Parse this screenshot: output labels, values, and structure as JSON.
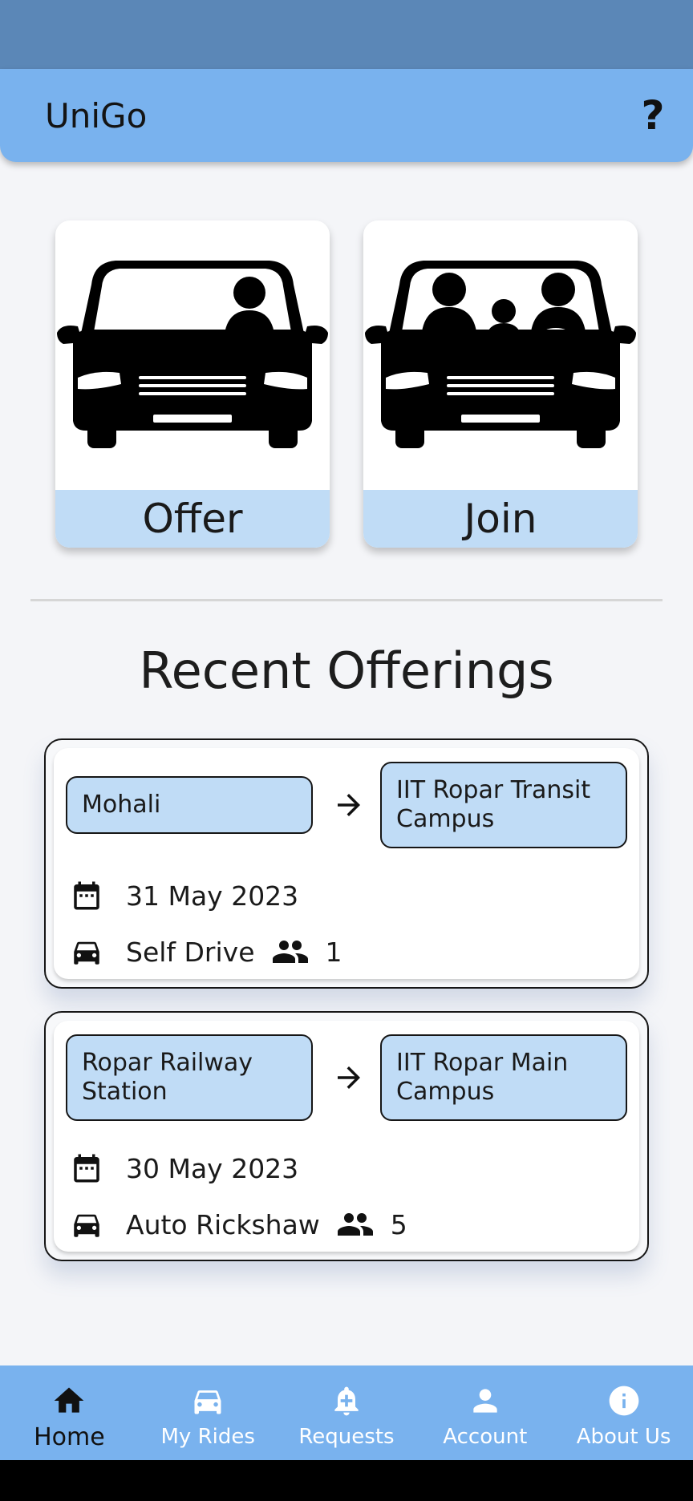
{
  "app_bar": {
    "title": "UniGo",
    "help_label": "?"
  },
  "tiles": {
    "offer_label": "Offer",
    "join_label": "Join"
  },
  "recent": {
    "title": "Recent Offerings",
    "rides": [
      {
        "from": "Mohali",
        "to": "IIT Ropar Transit Campus",
        "date": "31 May 2023",
        "mode": "Self Drive",
        "seats": "1"
      },
      {
        "from": "Ropar Railway Station",
        "to": "IIT Ropar Main Campus",
        "date": "30 May 2023",
        "mode": "Auto Rickshaw",
        "seats": "5"
      }
    ]
  },
  "nav": {
    "items": [
      {
        "label": "Home",
        "icon": "home-icon",
        "active": true
      },
      {
        "label": "My Rides",
        "icon": "car-icon",
        "active": false
      },
      {
        "label": "Requests",
        "icon": "bell-plus-icon",
        "active": false
      },
      {
        "label": "Account",
        "icon": "person-icon",
        "active": false
      },
      {
        "label": "About Us",
        "icon": "info-icon",
        "active": false
      }
    ]
  },
  "colors": {
    "status_bar": "#5b87b7",
    "app_bar": "#79b2ee",
    "chip": "#c0dcf6",
    "background": "#f4f5f8"
  }
}
